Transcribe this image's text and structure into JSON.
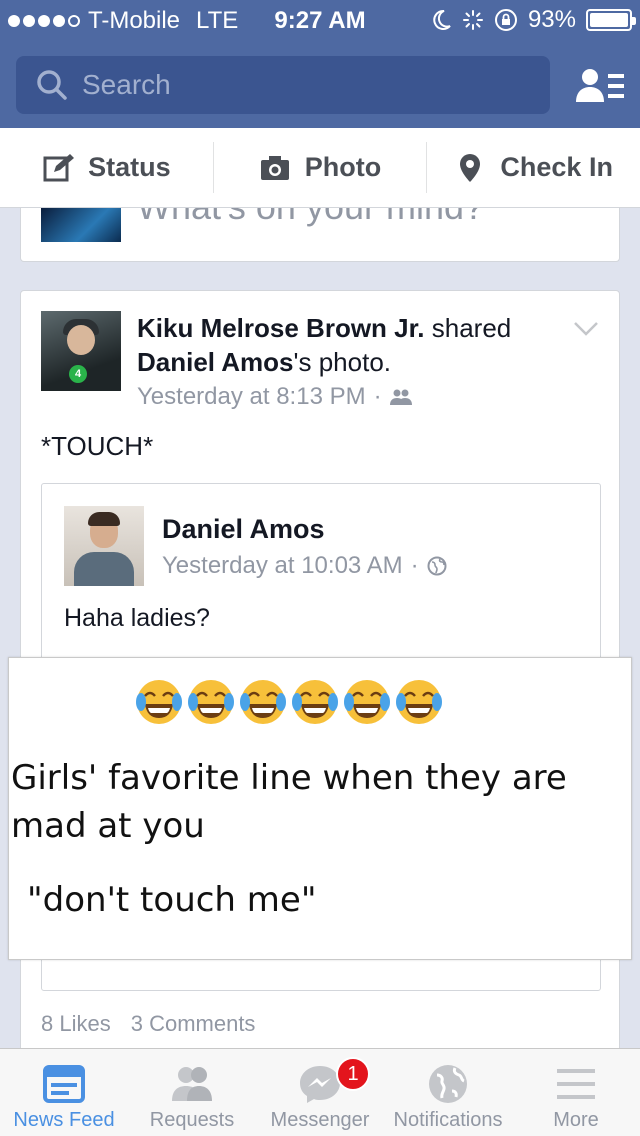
{
  "status_bar": {
    "carrier": "T-Mobile",
    "network": "LTE",
    "time": "9:27 AM",
    "battery": "93%",
    "signal_bars": 4
  },
  "search": {
    "placeholder": "Search"
  },
  "composer": {
    "status_label": "Status",
    "photo_label": "Photo",
    "checkin_label": "Check In",
    "prompt": "What's on your mind?"
  },
  "post": {
    "author": "Kiku Melrose Brown Jr.",
    "action": " shared",
    "shared_owner": "Daniel Amos",
    "shared_suffix": "'s photo.",
    "timestamp": "Yesterday at 8:13 PM",
    "separator": "·",
    "message": "*TOUCH*",
    "shared_post": {
      "name": "Daniel Amos",
      "timestamp": "Yesterday at 10:03 AM",
      "separator": "·",
      "caption": "Haha ladies?"
    },
    "likes": "8 Likes",
    "comments": "3 Comments"
  },
  "meme": {
    "line1": "Girls' favorite line when they are mad at you",
    "line2": "\"don't touch me\"",
    "emoji_count": 6
  },
  "tabbar": {
    "news_feed": "News Feed",
    "requests": "Requests",
    "messenger": "Messenger",
    "messenger_badge": "1",
    "notifications": "Notifications",
    "more": "More"
  },
  "colors": {
    "header_blue": "#4e69a2",
    "search_bg": "#3b5590",
    "active_tab": "#4a90e2",
    "badge_red": "#e3151d"
  }
}
